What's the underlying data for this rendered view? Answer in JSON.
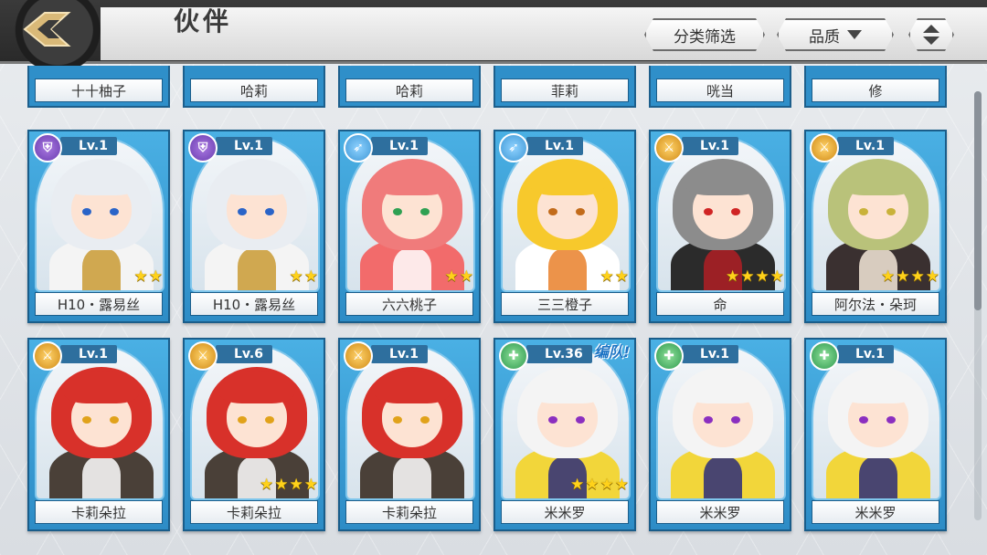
{
  "header": {
    "title": "伙伴",
    "sort_category_label": "分类筛选",
    "quality_label": "品质"
  },
  "partial_row": [
    "十十柚子",
    "哈莉",
    "哈莉",
    "菲莉",
    "咣当",
    "修"
  ],
  "cards": [
    {
      "name": "H10・露易丝",
      "level": "Lv.1",
      "class": "shield",
      "badge_color": "purple",
      "stars": "★★",
      "team": "",
      "hair": "#e9edf2",
      "outfit": "#f4f4f4",
      "eye": "#2a64c8",
      "accent": "#c99a33"
    },
    {
      "name": "H10・露易丝",
      "level": "Lv.1",
      "class": "shield",
      "badge_color": "purple",
      "stars": "★★",
      "team": "",
      "hair": "#e9edf2",
      "outfit": "#f4f4f4",
      "eye": "#2a64c8",
      "accent": "#c99a33"
    },
    {
      "name": "六六桃子",
      "level": "Lv.1",
      "class": "bow",
      "badge_color": "blue",
      "stars": "★★",
      "team": "",
      "hair": "#f07b7b",
      "outfit": "#f26b6b",
      "eye": "#2fa052",
      "accent": "#ffffff"
    },
    {
      "name": "三三橙子",
      "level": "Lv.1",
      "class": "bow",
      "badge_color": "blue",
      "stars": "★★",
      "team": "",
      "hair": "#f7c92c",
      "outfit": "#ffffff",
      "eye": "#c26b1a",
      "accent": "#e9802a"
    },
    {
      "name": "命",
      "level": "Lv.1",
      "class": "sword",
      "badge_color": "gold",
      "stars": "★★★★",
      "team": "",
      "hair": "#8c8c8c",
      "outfit": "#2b2b2b",
      "eye": "#d02424",
      "accent": "#b01f25"
    },
    {
      "name": "阿尔法・朵珂",
      "level": "Lv.1",
      "class": "sword",
      "badge_color": "gold",
      "stars": "★★★★",
      "team": "",
      "hair": "#b9c27a",
      "outfit": "#3a3030",
      "eye": "#c9b23a",
      "accent": "#f5e7d8"
    },
    {
      "name": "卡莉朵拉",
      "level": "Lv.1",
      "class": "sword",
      "badge_color": "gold",
      "stars": "",
      "team": "",
      "hair": "#d8312a",
      "outfit": "#4a4038",
      "eye": "#e1a21a",
      "accent": "#ffffff"
    },
    {
      "name": "卡莉朵拉",
      "level": "Lv.6",
      "class": "sword",
      "badge_color": "gold",
      "stars": "★★★★",
      "team": "",
      "hair": "#d8312a",
      "outfit": "#4a4038",
      "eye": "#e1a21a",
      "accent": "#ffffff"
    },
    {
      "name": "卡莉朵拉",
      "level": "Lv.1",
      "class": "sword",
      "badge_color": "gold",
      "stars": "",
      "team": "",
      "hair": "#d8312a",
      "outfit": "#4a4038",
      "eye": "#e1a21a",
      "accent": "#ffffff"
    },
    {
      "name": "米米罗",
      "level": "Lv.36",
      "class": "cross",
      "badge_color": "green",
      "stars": "★★★★",
      "team": "编队!",
      "hair": "#f4f4f4",
      "outfit": "#f2d63a",
      "eye": "#8b2fc0",
      "accent": "#2c2c7a"
    },
    {
      "name": "米米罗",
      "level": "Lv.1",
      "class": "cross",
      "badge_color": "green",
      "stars": "",
      "team": "",
      "hair": "#f4f4f4",
      "outfit": "#f2d63a",
      "eye": "#8b2fc0",
      "accent": "#2c2c7a"
    },
    {
      "name": "米米罗",
      "level": "Lv.1",
      "class": "cross",
      "badge_color": "green",
      "stars": "",
      "team": "",
      "hair": "#f4f4f4",
      "outfit": "#f2d63a",
      "eye": "#8b2fc0",
      "accent": "#2c2c7a"
    }
  ],
  "class_icons": {
    "shield": "⛨",
    "bow": "➶",
    "sword": "⚔",
    "cross": "✚"
  }
}
